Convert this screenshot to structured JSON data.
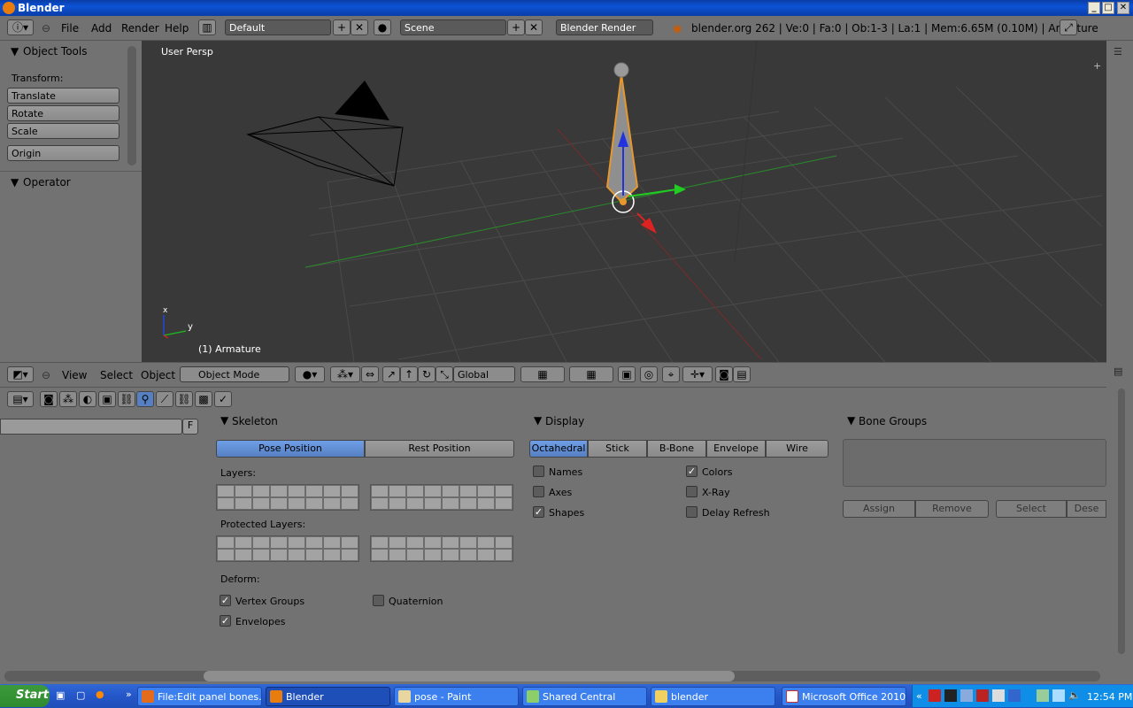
{
  "window": {
    "title": "Blender"
  },
  "info_header": {
    "menus": [
      "File",
      "Add",
      "Render",
      "Help"
    ],
    "screen_layout": "Default",
    "scene": "Scene",
    "render_engine": "Blender Render",
    "stats": "blender.org 262 | Ve:0 | Fa:0 | Ob:1-3 | La:1 | Mem:6.65M (0.10M) | Armature"
  },
  "tools": {
    "title": "Object Tools",
    "transform_label": "Transform:",
    "buttons": [
      "Translate",
      "Rotate",
      "Scale"
    ],
    "origin": "Origin",
    "operator": "Operator"
  },
  "viewport": {
    "view_label": "User Persp",
    "object_label": "(1) Armature",
    "axis_y": "y",
    "axis_x": "x"
  },
  "view3d_header": {
    "menus": [
      "View",
      "Select",
      "Object"
    ],
    "mode": "Object Mode",
    "orientation": "Global"
  },
  "props_header": {
    "search_filter": "F"
  },
  "skeleton": {
    "title": "Skeleton",
    "pose_position": "Pose Position",
    "rest_position": "Rest Position",
    "layers_label": "Layers:",
    "protected_label": "Protected Layers:",
    "deform_label": "Deform:",
    "vertex_groups": "Vertex Groups",
    "envelopes": "Envelopes",
    "quaternion": "Quaternion"
  },
  "display": {
    "title": "Display",
    "modes": [
      "Octahedral",
      "Stick",
      "B-Bone",
      "Envelope",
      "Wire"
    ],
    "names": "Names",
    "axes": "Axes",
    "shapes": "Shapes",
    "colors": "Colors",
    "xray": "X-Ray",
    "delay_refresh": "Delay Refresh"
  },
  "bone_groups": {
    "title": "Bone Groups",
    "assign": "Assign",
    "remove": "Remove",
    "select": "Select",
    "deselect": "Dese"
  },
  "taskbar": {
    "start": "Start",
    "tasks": [
      "File:Edit panel bones...",
      "Blender",
      "pose - Paint",
      "Shared Central",
      "blender",
      "Microsoft Office 2010"
    ],
    "clock": "12:54 PM"
  }
}
